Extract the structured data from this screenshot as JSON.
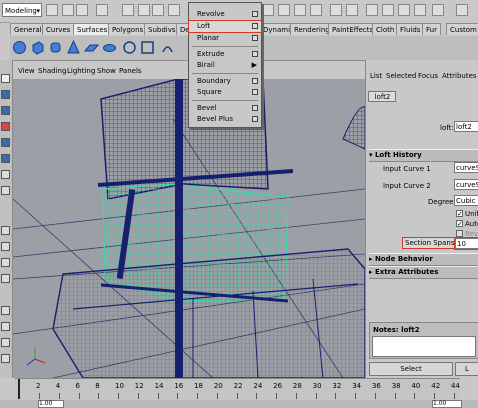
{
  "status_bar": {
    "mode": "Modeling"
  },
  "shelf_tabs": [
    "General",
    "Curves",
    "Surfaces",
    "Polygons",
    "Subdivs",
    "De",
    "Dynamics",
    "Rendering",
    "PaintEffects",
    "Cloth",
    "Fluids",
    "Fur",
    "Custom"
  ],
  "active_shelf_tab": "Surfaces",
  "panel_menu": [
    "View",
    "Shading",
    "Lighting",
    "Show",
    "Panels"
  ],
  "menu": {
    "items": [
      {
        "label": "Revolve",
        "option": true
      },
      {
        "label": "Loft",
        "option": true,
        "highlighted": true
      },
      {
        "label": "Planar",
        "option": true
      },
      {
        "label": "Extrude",
        "option": true
      },
      {
        "label": "Birail",
        "submenu": true
      },
      {
        "label": "Boundary",
        "option": true
      },
      {
        "label": "Square",
        "option": true
      },
      {
        "label": "Bevel",
        "option": true
      },
      {
        "label": "Bevel Plus",
        "option": true
      }
    ],
    "submenu_arrow": "▶"
  },
  "attribute_editor": {
    "menu": [
      "List",
      "Selected",
      "Focus",
      "Attributes"
    ],
    "tab": "loft2",
    "node_label": "loft:",
    "node_value": "loft2",
    "loft_history_title": "Loft History",
    "input_curve1_label": "Input Curve 1",
    "input_curve1_value": "curveSh",
    "input_curve2_label": "Input Curve 2",
    "input_curve2_value": "curveSh",
    "degree_label": "Degree",
    "degree_value": "Cubic",
    "uniform_label": "Unif",
    "auto_label": "Auto",
    "reverse_label": "Rev",
    "section_spans_label": "Section Spans",
    "section_spans_value": "10",
    "node_behavior_title": "Node Behavior",
    "extra_attributes_title": "Extra Attributes",
    "notes_label": "Notes: loft2",
    "select_button": "Select",
    "load_button": "L"
  },
  "timeline": {
    "ticks": [
      "2",
      "4",
      "6",
      "8",
      "10",
      "12",
      "14",
      "16",
      "18",
      "20",
      "22",
      "24",
      "26",
      "28",
      "30",
      "32",
      "34",
      "36",
      "38",
      "40",
      "42",
      "44"
    ],
    "start": "1.00",
    "current": "1.00"
  },
  "colors": {
    "highlight": "#d43a2a",
    "wire": "#16206e",
    "surface": "#3fd6a8"
  }
}
